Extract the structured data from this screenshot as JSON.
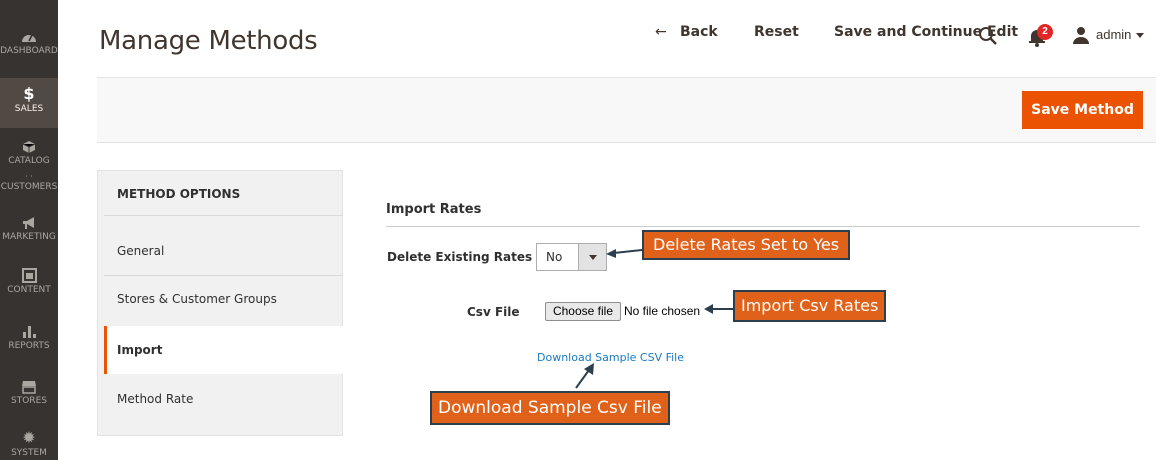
{
  "sidebar": {
    "items": [
      {
        "label": "DASHBOARD",
        "icon": "dashboard-icon"
      },
      {
        "label": "SALES",
        "icon": "dollar-icon",
        "active": true
      },
      {
        "label": "CATALOG",
        "icon": "cube-icon"
      },
      {
        "label": "CUSTOMERS",
        "icon": "customers-icon"
      },
      {
        "label": "MARKETING",
        "icon": "megaphone-icon"
      },
      {
        "label": "CONTENT",
        "icon": "content-icon"
      },
      {
        "label": "REPORTS",
        "icon": "bar-chart-icon"
      },
      {
        "label": "STORES",
        "icon": "store-icon"
      },
      {
        "label": "SYSTEM",
        "icon": "gear-icon"
      }
    ]
  },
  "header": {
    "title": "Manage Methods",
    "notification_count": "2",
    "user_name": "admin"
  },
  "actions": {
    "back_label": "Back",
    "reset_label": "Reset",
    "save_continue_label": "Save and Continue Edit",
    "save_method_label": "Save Method"
  },
  "tabs": {
    "heading": "METHOD OPTIONS",
    "items": [
      {
        "label": "General"
      },
      {
        "label": "Stores & Customer Groups"
      },
      {
        "label": "Import",
        "active": true
      },
      {
        "label": "Method Rate"
      }
    ]
  },
  "form": {
    "section_title": "Import Rates",
    "delete_label": "Delete Existing Rates",
    "delete_value": "No",
    "csv_label": "Csv File",
    "choose_file_label": "Choose file",
    "file_status": "No file chosen",
    "download_link": "Download Sample CSV File"
  },
  "annotations": {
    "delete_callout": "Delete Rates Set to Yes",
    "import_callout": "Import Csv Rates",
    "download_callout": "Download  Sample Csv File"
  },
  "colors": {
    "accent": "#eb5202",
    "sidebar_bg": "#373330",
    "link": "#1979c3",
    "callout_bg": "#e0621a",
    "callout_border": "#2b3f4f"
  }
}
